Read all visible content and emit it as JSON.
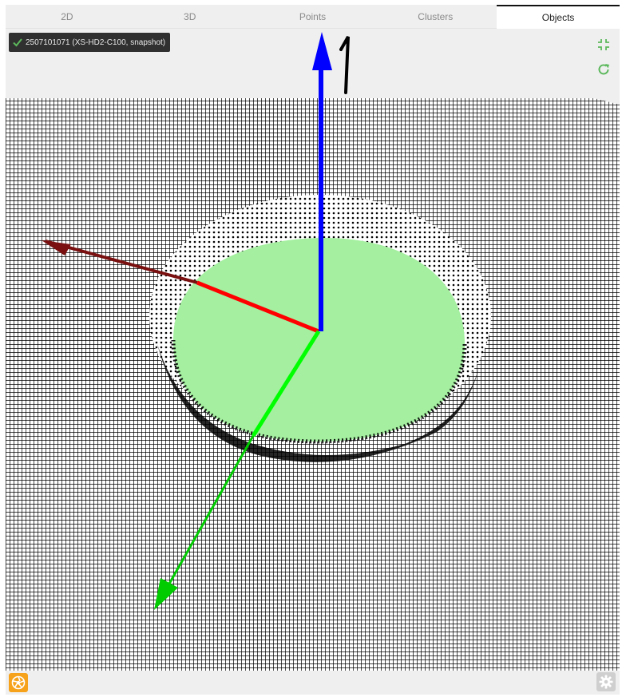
{
  "tabs": [
    {
      "label": "2D",
      "active": false
    },
    {
      "label": "3D",
      "active": false
    },
    {
      "label": "Points",
      "active": false
    },
    {
      "label": "Clusters",
      "active": false
    },
    {
      "label": "Objects",
      "active": true
    }
  ],
  "device": {
    "label": "2507101071 (XS-HD2-C100, snapshot)",
    "status_icon": "check-icon"
  },
  "viewport": {
    "background_color": "#efefef",
    "grid_color": "#000000",
    "object_fill_color": "#a4f0a0",
    "axes": {
      "x_color": "#ff0000",
      "y_color": "#00ff00",
      "z_color": "#0000ff"
    },
    "z_axis_marker": "1"
  },
  "controls": {
    "collapse_icon": "collapse-icon",
    "reset_icon": "refresh-icon",
    "accent_color": "#5cb85c"
  },
  "footer": {
    "logo_icon": "aperture-logo-icon",
    "settings_icon": "gear-icon",
    "logo_color": "#f6a21a"
  }
}
